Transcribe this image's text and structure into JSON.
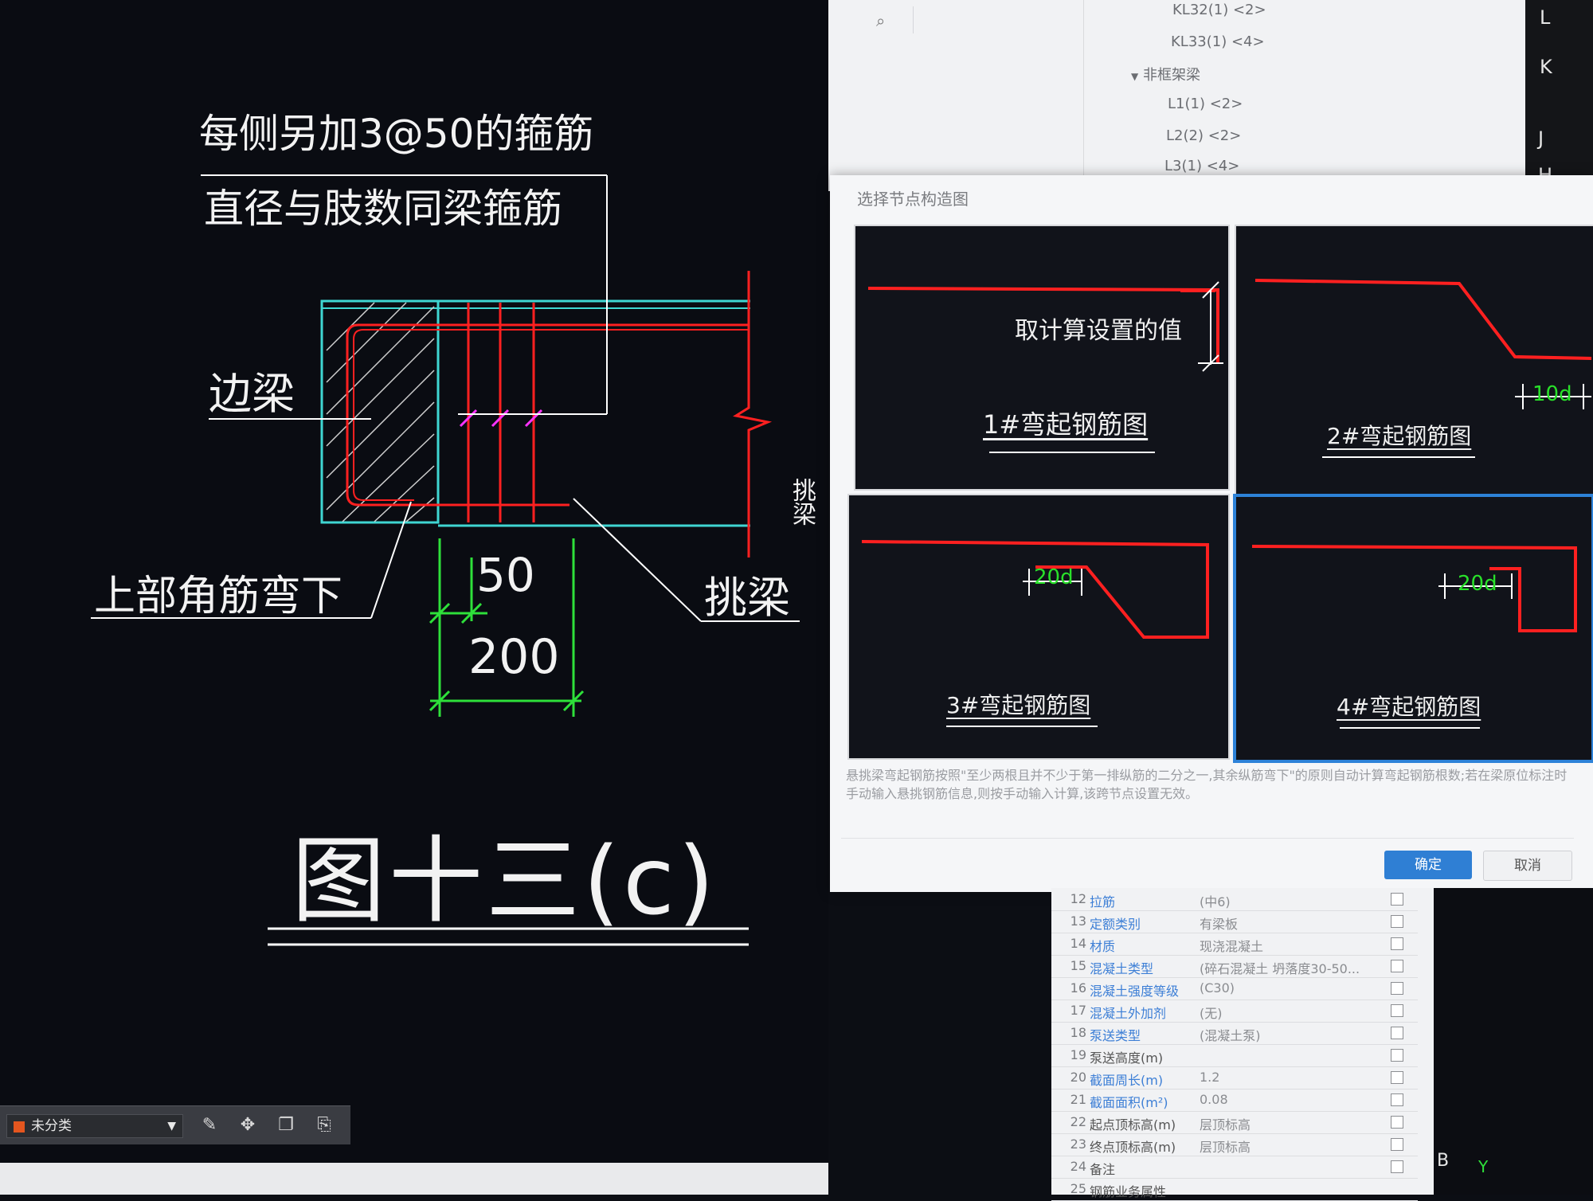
{
  "cad": {
    "note_line1": "每侧另加3@50的箍筋",
    "note_line2": "直径与肢数同梁箍筋",
    "label_edge_beam": "边梁",
    "label_top_bar": "上部角筋弯下",
    "label_cantilever": "挑梁",
    "label_side": "挑梁",
    "dim_50": "50",
    "dim_200": "200",
    "figure_title": "图十三(c)"
  },
  "toolbar": {
    "layer_label": "未分类",
    "layer_color": "#e4561f"
  },
  "tree": {
    "items": [
      {
        "label": "KL32(1) <2>"
      },
      {
        "label": "KL33(1) <4>"
      },
      {
        "label": "非框架梁"
      },
      {
        "label": "L1(1) <2>"
      },
      {
        "label": "L2(2) <2>"
      },
      {
        "label": "L3(1) <4>"
      }
    ]
  },
  "axis_labels": [
    "L",
    "K",
    "J",
    "H"
  ],
  "dialog": {
    "title": "选择节点构造图",
    "options": [
      {
        "caption": "1#弯起钢筋图",
        "note": "取计算设置的值"
      },
      {
        "caption": "2#弯起钢筋图",
        "dim": "10d"
      },
      {
        "caption": "3#弯起钢筋图",
        "dim": "20d"
      },
      {
        "caption": "4#弯起钢筋图",
        "dim": "20d",
        "selected": true
      }
    ],
    "description": "悬挑梁弯起钢筋按照\"至少两根且并不少于第一排纵筋的二分之一,其余纵筋弯下\"的原则自动计算弯起钢筋根数;若在梁原位标注时手动输入悬挑钢筋信息,则按手动输入计算,该跨节点设置无效。",
    "ok_label": "确定",
    "cancel_label": "取消",
    "accent_color": "#2f7fd4"
  },
  "properties": {
    "rows": [
      {
        "num": "12",
        "name": "拉筋",
        "value": "(中6)",
        "blue": true
      },
      {
        "num": "13",
        "name": "定额类别",
        "value": "有梁板",
        "blue": true
      },
      {
        "num": "14",
        "name": "材质",
        "value": "现浇混凝土",
        "blue": true
      },
      {
        "num": "15",
        "name": "混凝土类型",
        "value": "(碎石混凝土 坍落度30-50...",
        "blue": true
      },
      {
        "num": "16",
        "name": "混凝土强度等级",
        "value": "(C30)",
        "blue": true
      },
      {
        "num": "17",
        "name": "混凝土外加剂",
        "value": "(无)",
        "blue": true
      },
      {
        "num": "18",
        "name": "泵送类型",
        "value": "(混凝土泵)",
        "blue": true
      },
      {
        "num": "19",
        "name": "泵送高度(m)",
        "value": "",
        "blue": false
      },
      {
        "num": "20",
        "name": "截面周长(m)",
        "value": "1.2",
        "blue": true
      },
      {
        "num": "21",
        "name": "截面面积(m²)",
        "value": "0.08",
        "blue": true
      },
      {
        "num": "22",
        "name": "起点顶标高(m)",
        "value": "层顶标高",
        "blue": false
      },
      {
        "num": "23",
        "name": "终点顶标高(m)",
        "value": "层顶标高",
        "blue": false
      },
      {
        "num": "24",
        "name": "备注",
        "value": "",
        "blue": false
      },
      {
        "num": "25",
        "name": "钢筋业务属性",
        "value": "",
        "blue": false
      }
    ]
  },
  "axis_b": "B",
  "axis_y": "Y"
}
